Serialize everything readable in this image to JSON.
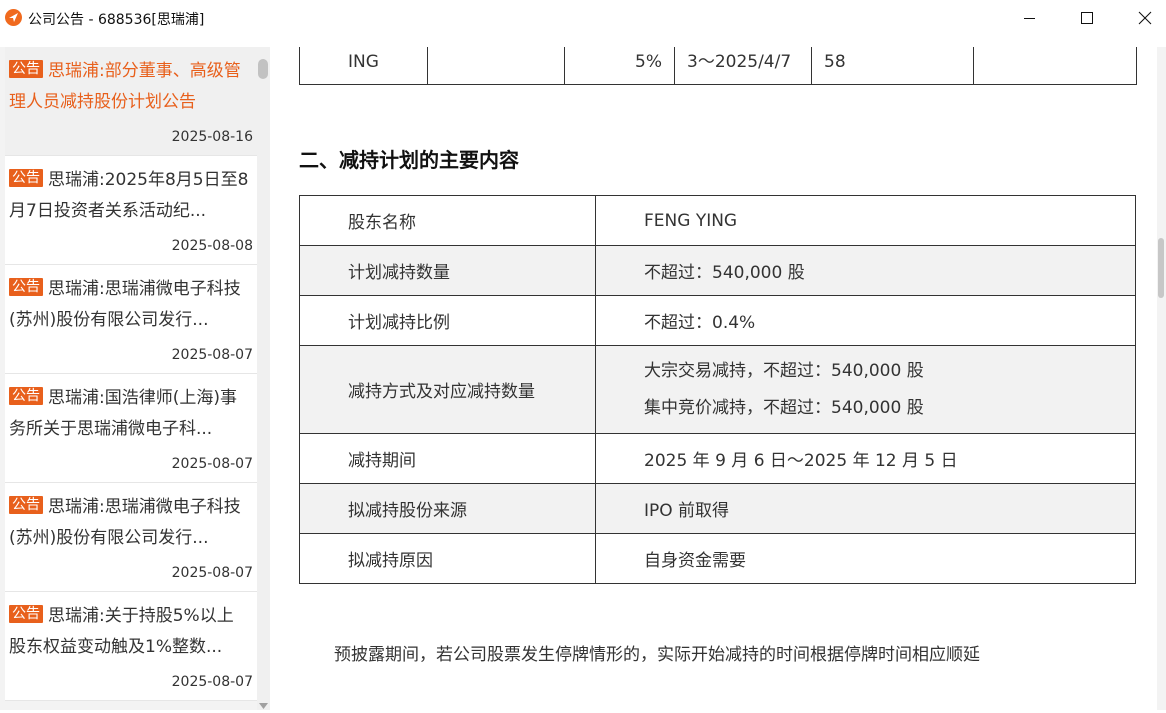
{
  "window": {
    "title": "公司公告 - 688536[思瑞浦]"
  },
  "sidebar": {
    "items": [
      {
        "tag": "公告",
        "title": "思瑞浦:部分董事、高级管理人员减持股份计划公告",
        "date": "2025-08-16",
        "active": true
      },
      {
        "tag": "公告",
        "title": "思瑞浦:2025年8月5日至8月7日投资者关系活动纪...",
        "date": "2025-08-08"
      },
      {
        "tag": "公告",
        "title": "思瑞浦:思瑞浦微电子科技(苏州)股份有限公司发行...",
        "date": "2025-08-07"
      },
      {
        "tag": "公告",
        "title": "思瑞浦:国浩律师(上海)事务所关于思瑞浦微电子科...",
        "date": "2025-08-07"
      },
      {
        "tag": "公告",
        "title": "思瑞浦:思瑞浦微电子科技(苏州)股份有限公司发行...",
        "date": "2025-08-07"
      },
      {
        "tag": "公告",
        "title": "思瑞浦:关于持股5%以上股东权益变动触及1%整数...",
        "date": "2025-08-07"
      }
    ]
  },
  "top_table": {
    "cells": [
      "ING",
      "5%",
      "3～2025/4/7",
      "58"
    ]
  },
  "section": {
    "heading": "二、减持计划的主要内容"
  },
  "plan_table": {
    "rows": [
      {
        "key": "股东名称",
        "value": "FENG YING"
      },
      {
        "key": "计划减持数量",
        "value": "不超过：540,000 股"
      },
      {
        "key": "计划减持比例",
        "value": "不超过：0.4%"
      },
      {
        "key": "减持方式及对应减持数量",
        "value_line1": "大宗交易减持，不超过：540,000 股",
        "value_line2": "集中竞价减持，不超过：540,000 股"
      },
      {
        "key": "减持期间",
        "value": "2025 年 9 月 6 日～2025 年 12 月 5 日"
      },
      {
        "key": "拟减持股份来源",
        "value": "IPO 前取得"
      },
      {
        "key": "拟减持原因",
        "value": "自身资金需要"
      }
    ]
  },
  "note": "预披露期间，若公司股票发生停牌情形的，实际开始减持的时间根据停牌时间相应顺延",
  "colors": {
    "accent": "#e8601c",
    "shade": "#f2f2f2"
  }
}
